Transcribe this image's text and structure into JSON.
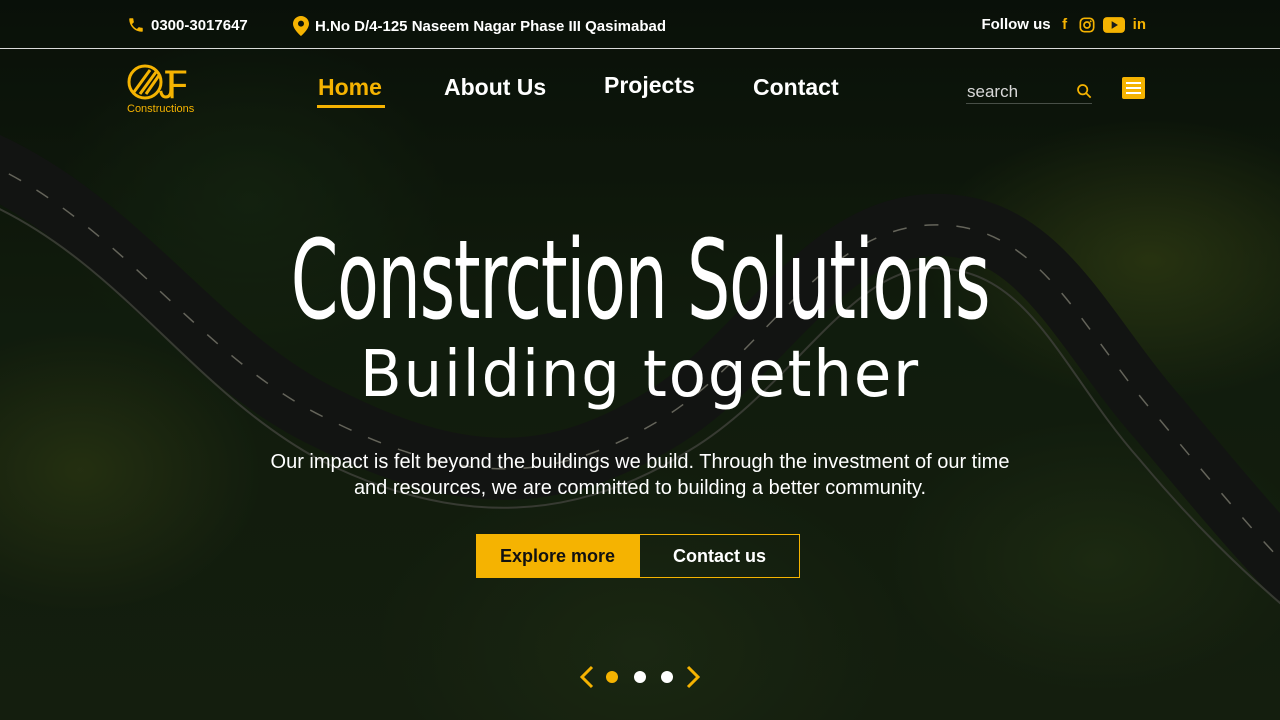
{
  "colors": {
    "accent": "#f5b301",
    "text": "#ffffff"
  },
  "topbar": {
    "phone": "0300-3017647",
    "phone_icon": "phone-icon",
    "address": "H.No D/4-125 Naseem Nagar Phase III Qasimabad",
    "address_icon": "location-pin-icon",
    "follow_label": "Follow us",
    "social": [
      {
        "name": "facebook",
        "glyph": "f"
      },
      {
        "name": "instagram",
        "glyph": ""
      },
      {
        "name": "youtube",
        "glyph": ""
      },
      {
        "name": "linkedin",
        "glyph": "in"
      }
    ]
  },
  "brand": {
    "logo_letters": "JF",
    "logo_text": "Constructions"
  },
  "nav": {
    "items": [
      {
        "label": "Home",
        "active": true
      },
      {
        "label": "About Us",
        "active": false
      },
      {
        "label": "Projects",
        "active": false
      },
      {
        "label": "Contact",
        "active": false
      }
    ],
    "search_placeholder": "search",
    "search_value": ""
  },
  "hero": {
    "title": "Constrction Solutions",
    "subtitle": "Building together",
    "paragraph": "Our impact is felt beyond the buildings we build. Through the investment of our time and resources, we are committed to building a better community.",
    "primary_button": "Explore more",
    "secondary_button": "Contact us"
  },
  "slider": {
    "slides": 3,
    "current": 1
  }
}
